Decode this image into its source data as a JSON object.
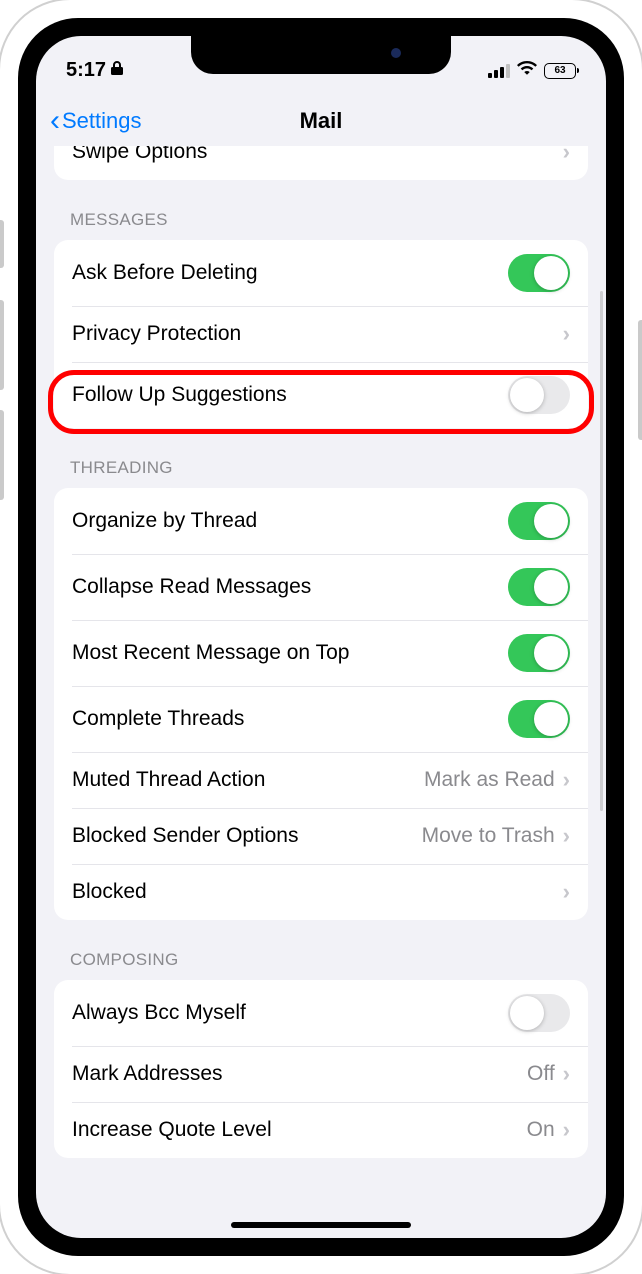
{
  "status": {
    "time": "5:17",
    "battery": "63"
  },
  "nav": {
    "back": "Settings",
    "title": "Mail"
  },
  "partial_top": {
    "label": "Swipe Options"
  },
  "sections": {
    "messages": {
      "header": "MESSAGES",
      "ask_before_deleting": "Ask Before Deleting",
      "privacy_protection": "Privacy Protection",
      "follow_up": "Follow Up Suggestions"
    },
    "threading": {
      "header": "THREADING",
      "organize": "Organize by Thread",
      "collapse": "Collapse Read Messages",
      "recent_top": "Most Recent Message on Top",
      "complete": "Complete Threads",
      "muted_action": {
        "label": "Muted Thread Action",
        "value": "Mark as Read"
      },
      "blocked_sender": {
        "label": "Blocked Sender Options",
        "value": "Move to Trash"
      },
      "blocked": "Blocked"
    },
    "composing": {
      "header": "COMPOSING",
      "bcc": "Always Bcc Myself",
      "mark_addresses": {
        "label": "Mark Addresses",
        "value": "Off"
      },
      "quote_level": {
        "label": "Increase Quote Level",
        "value": "On"
      }
    }
  }
}
